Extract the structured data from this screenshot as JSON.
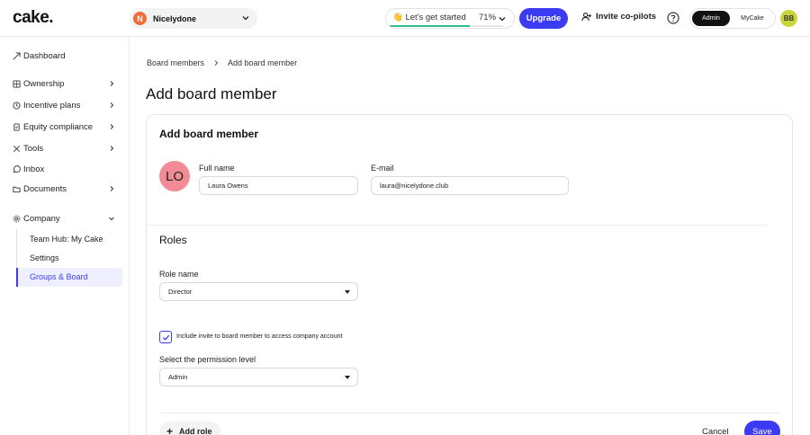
{
  "header": {
    "logo": "cake.",
    "company": {
      "initial": "N",
      "name": "Nicelydone"
    },
    "getting_started": {
      "label": "👋 Let's get started",
      "percent_text": "71%",
      "progress": 0.71,
      "progress_color": "#2ebd8a"
    },
    "upgrade_label": "Upgrade",
    "invite_label": "Invite co-pilots",
    "mode": {
      "admin_label": "Admin",
      "mycake_label": "MyCake",
      "selected": "Admin"
    },
    "user_initials": "BB"
  },
  "sidebar": {
    "items": [
      {
        "label": "Dashboard",
        "icon": "dashboard-icon"
      },
      {
        "label": "Ownership",
        "icon": "ownership-icon",
        "has_chevron": true
      },
      {
        "label": "Incentive plans",
        "icon": "incentive-icon",
        "has_chevron": true
      },
      {
        "label": "Equity compliance",
        "icon": "compliance-icon",
        "has_chevron": true
      },
      {
        "label": "Tools",
        "icon": "tools-icon",
        "has_chevron": true
      },
      {
        "label": "Inbox",
        "icon": "inbox-icon"
      },
      {
        "label": "Documents",
        "icon": "documents-icon",
        "has_chevron": true
      },
      {
        "label": "Company",
        "icon": "gear-icon",
        "has_chevron": true,
        "expanded": true
      }
    ],
    "company_sub": [
      "Team Hub: My Cake",
      "Settings",
      "Groups & Board"
    ],
    "active_sub": "Groups & Board"
  },
  "breadcrumb": [
    "Board members",
    "Add board member"
  ],
  "page_title": "Add board member",
  "form": {
    "card_title": "Add board member",
    "avatar_initials": "LO",
    "full_name": {
      "label": "Full name",
      "value": "Laura Owens"
    },
    "email": {
      "label": "E-mail",
      "value": "laura@nicelydone.club"
    },
    "roles_title": "Roles",
    "role_name": {
      "label": "Role name",
      "value": "Director"
    },
    "invite_checkbox": {
      "label": "Include invite to board member to access company account",
      "checked": true
    },
    "permission": {
      "label": "Select the permission level",
      "value": "Admin"
    },
    "add_role_label": "Add role",
    "cancel_label": "Cancel",
    "save_label": "Save"
  },
  "colors": {
    "accent": "#3b3bf3",
    "avatar_lo": "#f28b95",
    "user_avatar": "#c8d63b",
    "company_avatar": "#f26b3a"
  }
}
